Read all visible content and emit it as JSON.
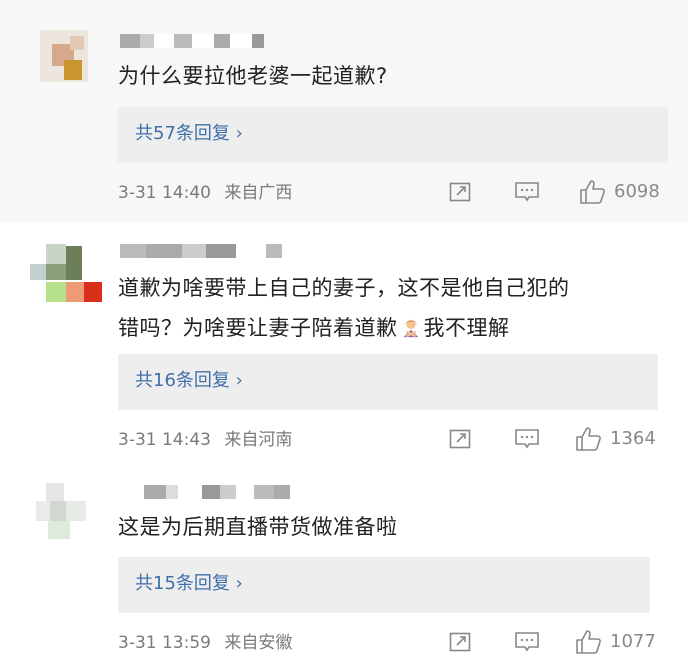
{
  "comments": [
    {
      "text_lines": [
        "为什么要拉他老婆一起道歉?"
      ],
      "replies": "共57条回复 ›",
      "time": "3-31 14:40",
      "location": "来自广西",
      "likes": "6098",
      "actions": [
        "share-icon",
        "comment-icon",
        "like-icon"
      ]
    },
    {
      "text_lines": [
        "道歉为啥要带上自己的妻子，这不是他自己犯的",
        "错吗？为啥要让妻子陪着道歉",
        "我不理解"
      ],
      "emoji": "woman-gesturing-no-emoji",
      "replies": "共16条回复 ›",
      "time": "3-31 14:43",
      "location": "来自河南",
      "likes": "1364"
    },
    {
      "text_lines": [
        "这是为后期直播带货做准备啦"
      ],
      "replies": "共15条回复 ›",
      "time": "3-31 13:59",
      "location": "来自安徽",
      "likes": "1077"
    }
  ],
  "colors": {
    "link": "#3f6fa8",
    "meta": "#7a7a7a",
    "text": "#222222",
    "reply_bg": "#eeeeee"
  }
}
